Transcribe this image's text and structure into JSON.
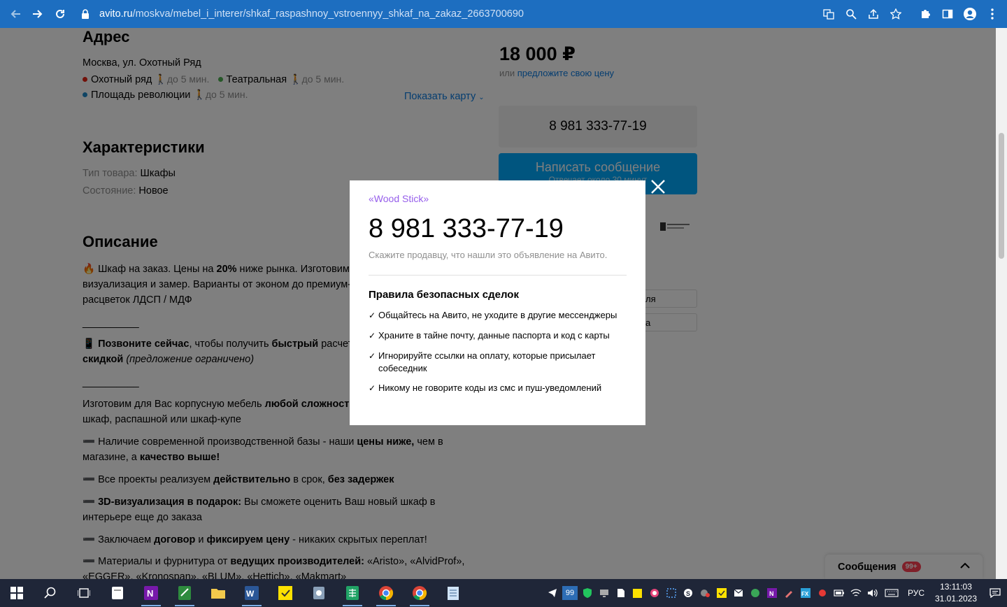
{
  "browser": {
    "url_host": "avito.ru",
    "url_path": "/moskva/mebel_i_interer/shkaf_raspashnoy_vstroennyy_shkaf_na_zakaz_2663700690"
  },
  "address": {
    "heading": "Адрес",
    "line": "Москва, ул. Охотный Ряд",
    "metro": [
      {
        "name": "Охотный ряд",
        "color": "#e42313",
        "walk": "до 5 мин."
      },
      {
        "name": "Театральная",
        "color": "#4caf50",
        "walk": "до 5 мин."
      },
      {
        "name": "Площадь революции",
        "color": "#1e88c8",
        "walk": "до 5 мин."
      }
    ],
    "show_map": "Показать карту"
  },
  "characteristics": {
    "heading": "Характеристики",
    "rows": [
      {
        "label": "Тип товара:",
        "value": "Шкафы"
      },
      {
        "label": "Состояние:",
        "value": "Новое"
      }
    ]
  },
  "description": {
    "heading": "Описание",
    "p1a": "Шкаф на заказ. Цены на ",
    "p1b": "20%",
    "p1c": " ниже рынка. Изготовим",
    "p1d": "визуализация и замер. Варианты от эконом до премиум-",
    "p1e": "расцветок ЛДСП / МДФ",
    "sep": "__________",
    "p2a": "Позвоните сейчас",
    "p2b": ", чтобы получить ",
    "p2c": "быстрый",
    "p2d": " расчет",
    "p2e": "скидкой",
    "p2f": "(предложение ограничено)",
    "p3a": "Изготовим для Вас корпусную мебель ",
    "p3b": "любой сложности",
    "p3c": "шкаф, распашной или шкаф-купе",
    "p4a": "Наличие современной производственной базы - наши ",
    "p4b": "цены ниже,",
    "p4c": " чем в",
    "p4d": "магазине, а ",
    "p4e": "качество выше!",
    "p5a": "Все проекты реализуем ",
    "p5b": "действительно",
    "p5c": " в срок, ",
    "p5d": "без задержек",
    "p6a": "3D-визуализация в подарок:",
    "p6b": " Вы сможете оценить Ваш новый шкаф в",
    "p6c": "интерьере еще до заказа",
    "p7a": "Заключаем ",
    "p7b": "договор",
    "p7c": " и ",
    "p7d": "фиксируем цену",
    "p7e": " - никаких скрытых переплат!",
    "p8a": "Материалы и фурнитура от ",
    "p8b": "ведущих производителей:",
    "p8c": " «Aristo», «AlvidProf»,",
    "p8d": "«EGGER», «Kronospan», «BLUM», «Hettich», «Makmart»"
  },
  "sidebar": {
    "price": "18 000 ₽",
    "offer_prefix": "или ",
    "offer_link": "предложите свою цену",
    "phone_button": "8 981 333-77-19",
    "message_button": "Написать сообщение",
    "message_sub": "Отвечает около 30 минут",
    "box1": "ля",
    "box2": "а"
  },
  "modal": {
    "seller": "«Wood Stick»",
    "phone": "8 981 333-77-19",
    "hint": "Скажите продавцу, что нашли это объявление на Авито.",
    "rules_title": "Правила безопасных сделок",
    "rules": [
      "Общайтесь на Авито, не уходите в другие мессенджеры",
      "Храните в тайне почту, данные паспорта и код с карты",
      "Игнорируйте ссылки на оплату, которые присылает собеседник",
      "Никому не говорите коды из смс и пуш-уведомлений"
    ]
  },
  "chat": {
    "label": "Сообщения",
    "badge": "99+"
  },
  "taskbar": {
    "tray_number": "99",
    "language": "РУС",
    "time": "13:11:03",
    "date": "31.01.2023"
  }
}
